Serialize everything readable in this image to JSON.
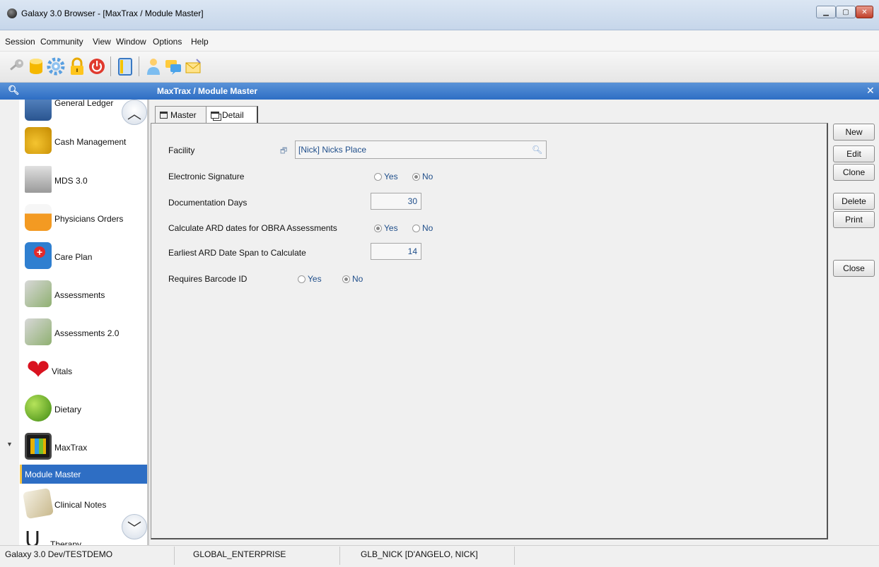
{
  "window": {
    "title": "Galaxy 3.0 Browser - [MaxTrax / Module Master]"
  },
  "menu": [
    "Session",
    "Community",
    "View",
    "Window",
    "Options",
    "Help"
  ],
  "toolbar_icons": [
    "key-icon",
    "database-icon",
    "gear-icon",
    "lock-icon",
    "power-icon",
    "notebook-icon",
    "user-icon",
    "chat-icon",
    "mail-icon"
  ],
  "panel": {
    "title": "MaxTrax / Module Master"
  },
  "sidebar": {
    "items": [
      {
        "label": "General Ledger",
        "icon": "ledger-icon"
      },
      {
        "label": "Cash Management",
        "icon": "coins-icon"
      },
      {
        "label": "MDS 3.0",
        "icon": "mds-icon"
      },
      {
        "label": "Physicians Orders",
        "icon": "pill-bottle-icon"
      },
      {
        "label": "Care Plan",
        "icon": "first-aid-icon"
      },
      {
        "label": "Assessments",
        "icon": "checklist-icon"
      },
      {
        "label": "Assessments 2.0",
        "icon": "checklist-icon"
      },
      {
        "label": "Vitals",
        "icon": "heart-icon"
      },
      {
        "label": "Dietary",
        "icon": "apple-icon"
      },
      {
        "label": "MaxTrax",
        "icon": "tablet-icon"
      },
      {
        "label": "Clinical Notes",
        "icon": "notes-icon"
      },
      {
        "label": "Therapy",
        "icon": "stethoscope-icon"
      }
    ],
    "active_sub_item": "Module Master"
  },
  "tabs": [
    {
      "label": "Master"
    },
    {
      "label": "Detail"
    }
  ],
  "form": {
    "facility": {
      "label": "Facility",
      "value": "[Nick] Nicks Place"
    },
    "electronic_signature": {
      "label": "Electronic Signature",
      "yes": "Yes",
      "no": "No",
      "selected": "No"
    },
    "documentation_days": {
      "label": "Documentation Days",
      "value": "30"
    },
    "calculate_ard": {
      "label": "Calculate ARD dates for OBRA Assessments",
      "yes": "Yes",
      "no": "No",
      "selected": "Yes"
    },
    "earliest_ard": {
      "label": "Earliest ARD Date Span to Calculate",
      "value": "14"
    },
    "requires_barcode": {
      "label": "Requires Barcode ID",
      "yes": "Yes",
      "no": "No",
      "selected": "No"
    }
  },
  "side_buttons": {
    "new": "New",
    "edit": "Edit",
    "clone": "Clone",
    "delete": "Delete",
    "print": "Print",
    "close": "Close"
  },
  "status": {
    "env": "Galaxy 3.0 Dev/TESTDEMO",
    "enterprise": "GLOBAL_ENTERPRISE",
    "user": "GLB_NICK [D'ANGELO, NICK]"
  },
  "colors": {
    "accent": "#2e6ec4",
    "value_text": "#1f4e8a"
  }
}
